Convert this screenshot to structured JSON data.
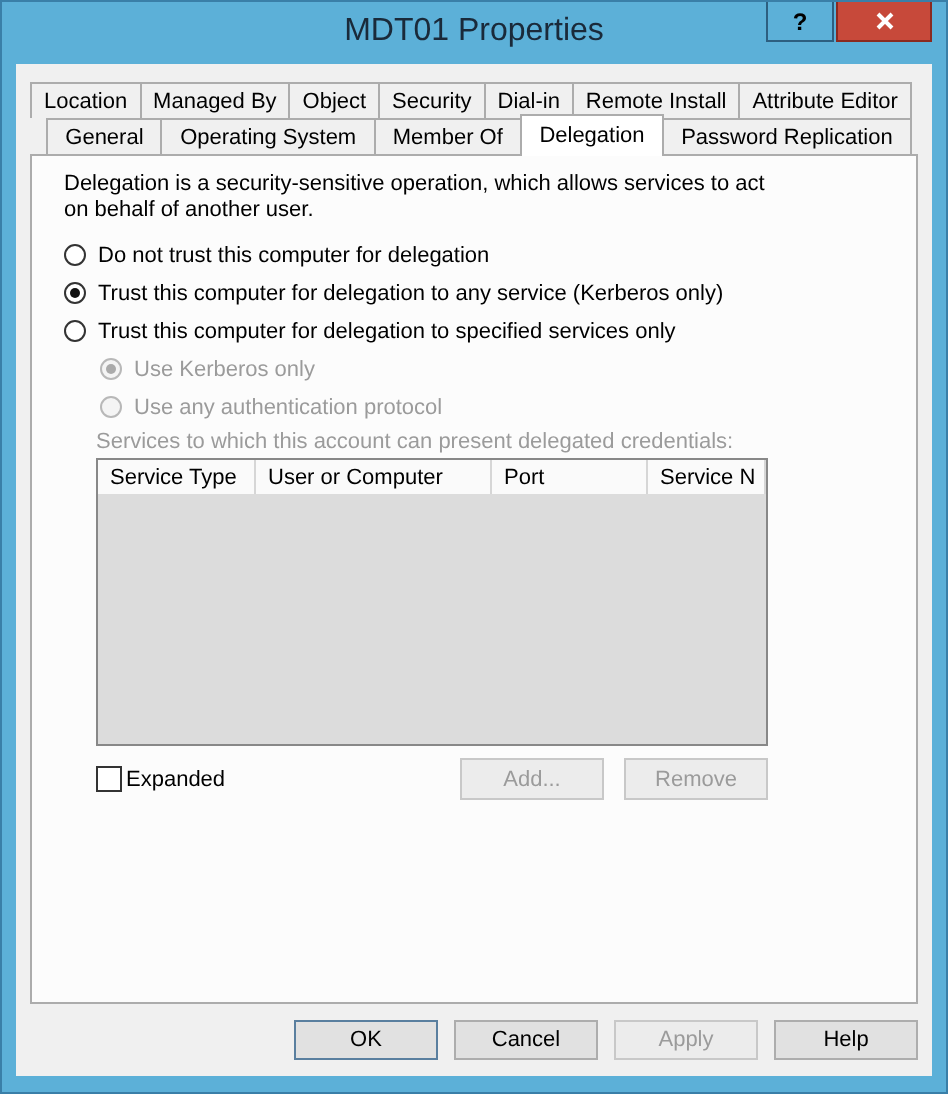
{
  "window": {
    "title": "MDT01 Properties",
    "help_button": "?"
  },
  "tab_rows": [
    [
      {
        "label": "Location",
        "selected": false
      },
      {
        "label": "Managed By",
        "selected": false
      },
      {
        "label": "Object",
        "selected": false
      },
      {
        "label": "Security",
        "selected": false
      },
      {
        "label": "Dial-in",
        "selected": false
      },
      {
        "label": "Remote Install",
        "selected": false
      },
      {
        "label": "Attribute Editor",
        "selected": false
      }
    ],
    [
      {
        "label": "General",
        "selected": false
      },
      {
        "label": "Operating System",
        "selected": false
      },
      {
        "label": "Member Of",
        "selected": false
      },
      {
        "label": "Delegation",
        "selected": true
      },
      {
        "label": "Password Replication",
        "selected": false
      }
    ]
  ],
  "description": "Delegation is a security-sensitive operation, which allows services to act on behalf of another user.",
  "options": [
    {
      "label": "Do not trust this computer for delegation",
      "selected": false,
      "disabled": false
    },
    {
      "label": "Trust this computer for delegation to any service (Kerberos only)",
      "selected": true,
      "disabled": false
    },
    {
      "label": "Trust this computer for delegation to specified services only",
      "selected": false,
      "disabled": false
    }
  ],
  "sub_options": [
    {
      "label": "Use Kerberos only",
      "selected": true,
      "disabled": true
    },
    {
      "label": "Use any authentication protocol",
      "selected": false,
      "disabled": true
    }
  ],
  "services_label": {
    "text": "Services to which this account can present delegated credentials:",
    "disabled": true
  },
  "services_table": {
    "columns": [
      "Service Type",
      "User or Computer",
      "Port",
      "Service N"
    ]
  },
  "expanded_checkbox": {
    "label": "Expanded",
    "checked": false
  },
  "list_buttons": [
    {
      "label": "Add...",
      "disabled": true
    },
    {
      "label": "Remove",
      "disabled": true
    }
  ],
  "dialog_buttons": [
    {
      "label": "OK",
      "disabled": false,
      "default": true
    },
    {
      "label": "Cancel",
      "disabled": false,
      "default": false
    },
    {
      "label": "Apply",
      "disabled": true,
      "default": false
    },
    {
      "label": "Help",
      "disabled": false,
      "default": false
    }
  ]
}
